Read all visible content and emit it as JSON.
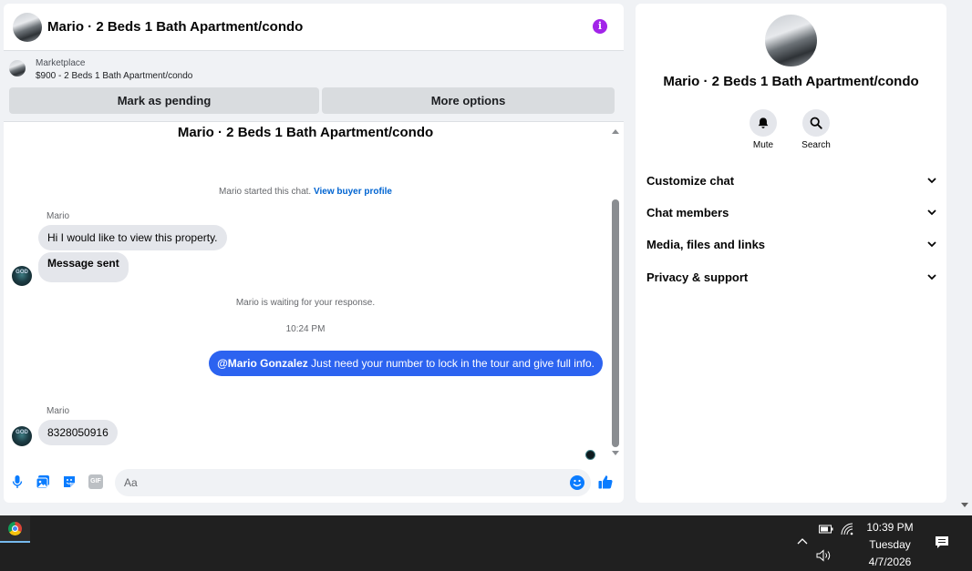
{
  "chat": {
    "header_title": "Mario · 2 Beds 1 Bath Apartment/condo",
    "info_glyph": "i",
    "listing": {
      "source": "Marketplace",
      "price_title": "$900 - 2 Beds 1 Bath Apartment/condo",
      "mark_pending_label": "Mark as pending",
      "more_options_label": "More options"
    },
    "thread_title": "Mario · 2 Beds 1 Bath Apartment/condo",
    "started_text": "Mario started this chat.",
    "view_profile_link": "View buyer profile",
    "messages": [
      {
        "sender": "Mario",
        "text": "Hi I would like to view this property."
      },
      {
        "text": "Message sent"
      }
    ],
    "waiting_text": "Mario is waiting for your response.",
    "timestamp": "10:24 PM",
    "outgoing": {
      "mention": "@Mario Gonzalez",
      "text": " Just need your number to lock in the tour and give full info."
    },
    "reply": {
      "sender": "Mario",
      "text": "8328050916"
    },
    "avatar_text": "GOD",
    "composer_placeholder": "Aa",
    "composer_icons": [
      "microphone-icon",
      "photo-icon",
      "sticker-icon",
      "gif-icon",
      "emoji-icon",
      "thumbs-up-icon"
    ],
    "gif_label": "GIF"
  },
  "details": {
    "title": "Mario · 2 Beds 1 Bath Apartment/condo",
    "actions": [
      {
        "icon": "bell-icon",
        "label": "Mute"
      },
      {
        "icon": "search-icon",
        "label": "Search"
      }
    ],
    "sections": [
      "Customize chat",
      "Chat members",
      "Media, files and links",
      "Privacy & support"
    ]
  },
  "taskbar": {
    "time": "10:39 PM",
    "day": "Tuesday",
    "date": "4/7/2026"
  },
  "colors": {
    "accent_blue": "#2c63f0",
    "messenger_blue": "#0a7cff",
    "info_purple": "#a224e9",
    "link_blue": "#0064d1"
  }
}
